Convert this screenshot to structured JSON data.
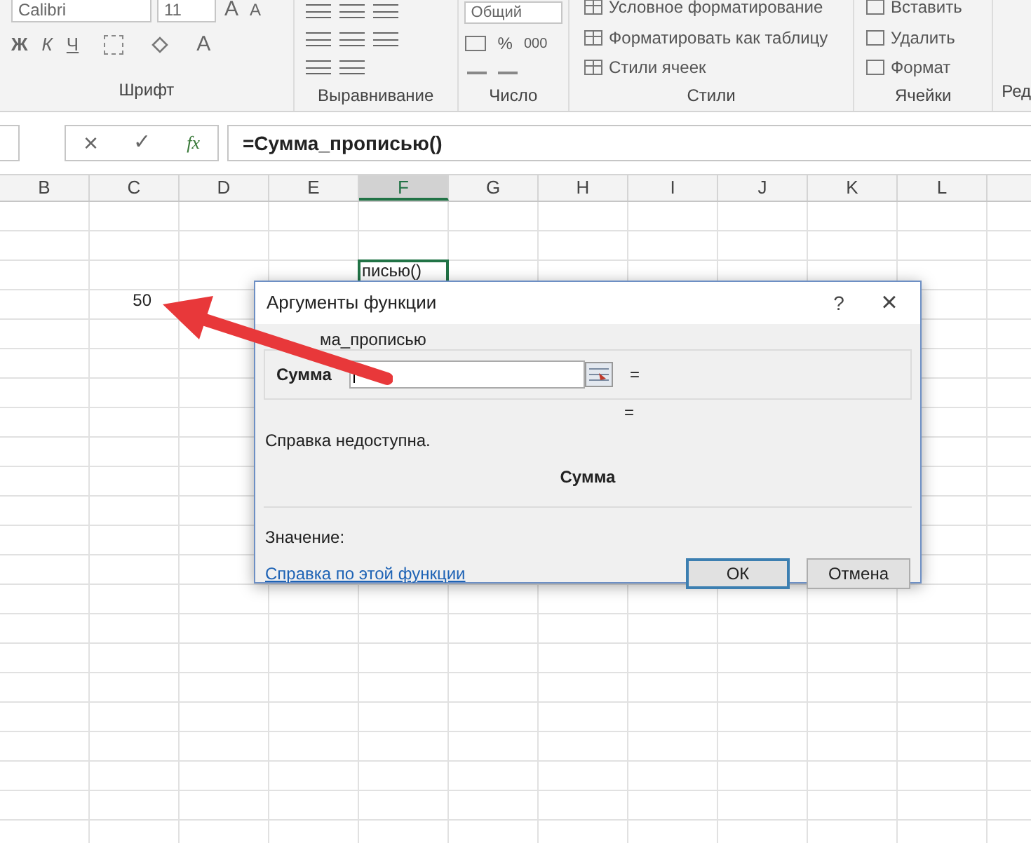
{
  "ribbon": {
    "font": {
      "name": "Calibri",
      "size": "11",
      "grow": "A",
      "shrink": "A",
      "bold": "Ж",
      "italic": "К",
      "underline": "Ч",
      "font_color_button": "A",
      "label": "Шрифт"
    },
    "alignment": {
      "label": "Выравнивание"
    },
    "number": {
      "format": "Общий",
      "percent": "%",
      "thousands": "000",
      "label": "Число"
    },
    "styles": {
      "items": [
        "Условное форматирование",
        "Форматировать как таблицу",
        "Стили ячеек"
      ],
      "label": "Стили"
    },
    "cells": {
      "items": [
        "Вставить",
        "Удалить",
        "Формат"
      ],
      "label": "Ячейки"
    },
    "editing": {
      "label": "Ред"
    }
  },
  "formula_bar": {
    "cancel": "×",
    "enter": "✓",
    "function": "fx",
    "formula": "=Сумма_прописью()"
  },
  "grid": {
    "columns": [
      {
        "label": "B",
        "selected": false
      },
      {
        "label": "C",
        "selected": false
      },
      {
        "label": "D",
        "selected": false
      },
      {
        "label": "E",
        "selected": false
      },
      {
        "label": "F",
        "selected": true
      },
      {
        "label": "G",
        "selected": false
      },
      {
        "label": "H",
        "selected": false
      },
      {
        "label": "I",
        "selected": false
      },
      {
        "label": "J",
        "selected": false
      },
      {
        "label": "K",
        "selected": false
      },
      {
        "label": "L",
        "selected": false
      }
    ],
    "cells": [
      {
        "text": "писью()",
        "selected": true
      },
      {
        "text": "50",
        "selected": false
      }
    ]
  },
  "dialog": {
    "title": "Аргументы функции",
    "help": "?",
    "close": "×",
    "group": "ма_прописью",
    "argument": {
      "label": "Сумма",
      "result": "="
    },
    "result": "=",
    "description": "Справка недоступна.",
    "argument_name": "Сумма",
    "value_label": "Значение:",
    "help_link": "Справка по этой функции",
    "buttons": [
      {
        "label": "ОК",
        "selected": true
      },
      {
        "label": "Отмена",
        "selected": false
      }
    ]
  }
}
